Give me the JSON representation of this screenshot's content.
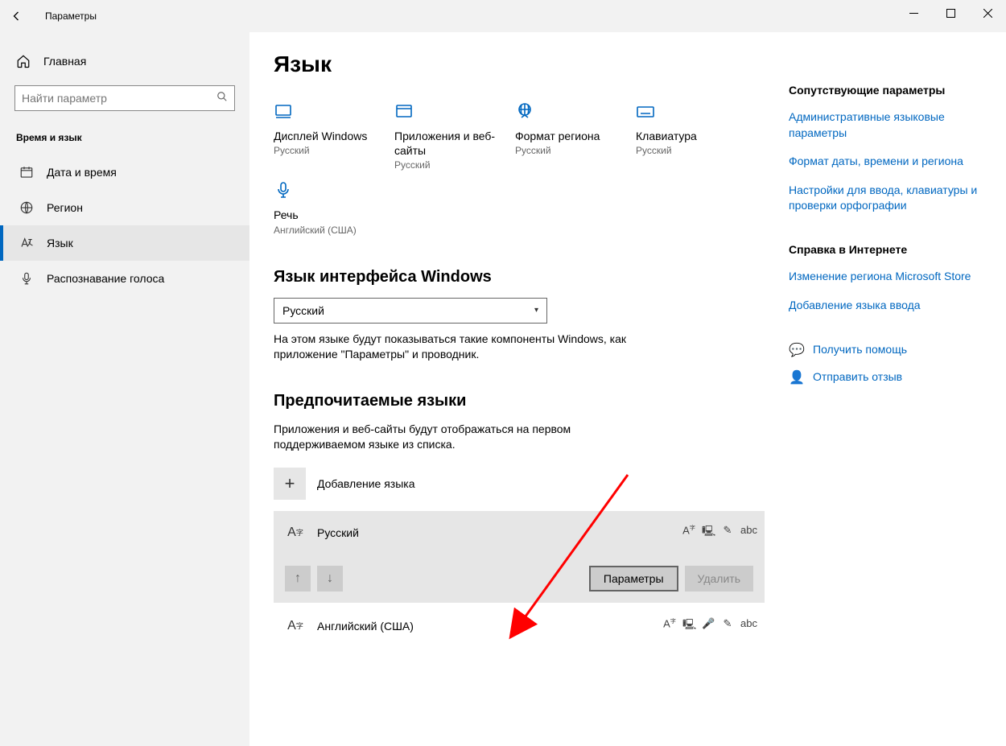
{
  "titlebar": {
    "title": "Параметры"
  },
  "sidebar": {
    "home": "Главная",
    "search_placeholder": "Найти параметр",
    "section": "Время и язык",
    "items": [
      {
        "label": "Дата и время"
      },
      {
        "label": "Регион"
      },
      {
        "label": "Язык"
      },
      {
        "label": "Распознавание голоса"
      }
    ]
  },
  "main": {
    "title": "Язык",
    "tiles": [
      {
        "title": "Дисплей Windows",
        "sub": "Русский"
      },
      {
        "title": "Приложения и веб-сайты",
        "sub": "Русский"
      },
      {
        "title": "Формат региона",
        "sub": "Русский"
      },
      {
        "title": "Клавиатура",
        "sub": "Русский"
      },
      {
        "title": "Речь",
        "sub": "Английский (США)"
      }
    ],
    "display_lang": {
      "heading": "Язык интерфейса Windows",
      "selected": "Русский",
      "desc": "На этом языке будут показываться такие компоненты Windows, как приложение \"Параметры\" и проводник."
    },
    "preferred": {
      "heading": "Предпочитаемые языки",
      "desc": "Приложения и веб-сайты будут отображаться на первом поддерживаемом языке из списка.",
      "add_label": "Добавление языка",
      "langs": [
        {
          "name": "Русский"
        },
        {
          "name": "Английский (США)"
        }
      ],
      "params_btn": "Параметры",
      "delete_btn": "Удалить"
    }
  },
  "right": {
    "related_h": "Сопутствующие параметры",
    "related_links": [
      "Административные языковые параметры",
      "Формат даты, времени и региона",
      "Настройки для ввода, клавиатуры и проверки орфографии"
    ],
    "web_h": "Справка в Интернете",
    "web_links": [
      "Изменение региона Microsoft Store",
      "Добавление языка ввода"
    ],
    "help": "Получить помощь",
    "feedback": "Отправить отзыв"
  }
}
